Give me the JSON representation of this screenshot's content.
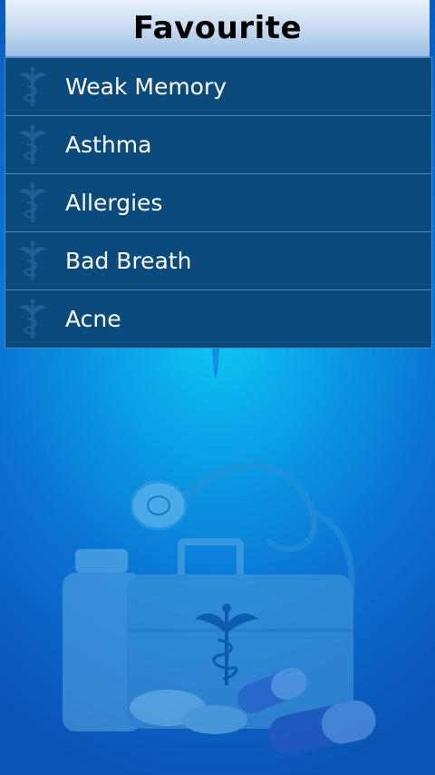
{
  "header": {
    "title": "Favourite"
  },
  "list": {
    "item_icon": "caduceus-icon",
    "items": [
      {
        "label": "Weak Memory"
      },
      {
        "label": "Asthma"
      },
      {
        "label": "Allergies"
      },
      {
        "label": "Bad Breath"
      },
      {
        "label": "Acne"
      }
    ]
  },
  "background": {
    "illustration": "medical-kit-stethoscope-pills-illustration"
  },
  "colors": {
    "row_background": "#0b4a7c",
    "row_text": "#ffffff",
    "header_text": "#000000",
    "background_center": "#0fc8f6",
    "background_edge": "#0a52b4"
  }
}
